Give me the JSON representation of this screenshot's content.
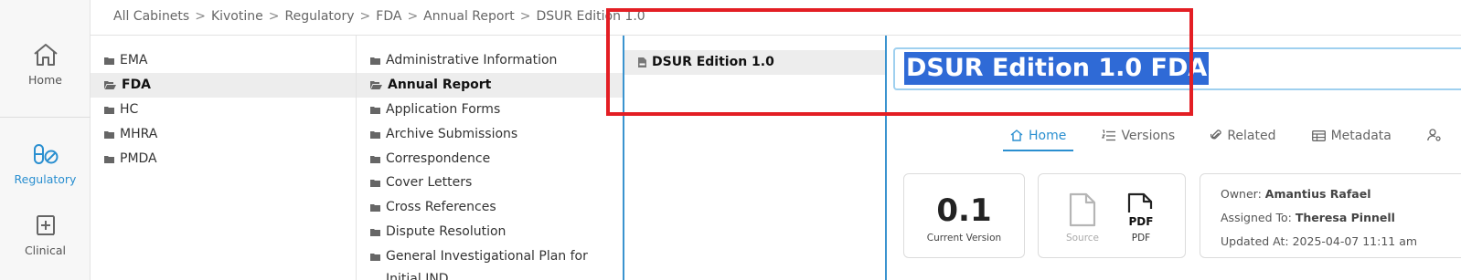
{
  "rail": {
    "home_label": "Home",
    "regulatory_label": "Regulatory",
    "clinical_label": "Clinical"
  },
  "breadcrumb": [
    "All Cabinets",
    "Kivotine",
    "Regulatory",
    "FDA",
    "Annual Report",
    "DSUR Edition 1.0"
  ],
  "breadcrumb_separator": ">",
  "column1": [
    {
      "label": "EMA",
      "selected": false
    },
    {
      "label": "FDA",
      "selected": true
    },
    {
      "label": "HC",
      "selected": false
    },
    {
      "label": "MHRA",
      "selected": false
    },
    {
      "label": "PMDA",
      "selected": false
    }
  ],
  "column2": [
    {
      "label": "Administrative Information",
      "selected": false
    },
    {
      "label": "Annual Report",
      "selected": true
    },
    {
      "label": "Application Forms",
      "selected": false
    },
    {
      "label": "Archive Submissions",
      "selected": false
    },
    {
      "label": "Correspondence",
      "selected": false
    },
    {
      "label": "Cover Letters",
      "selected": false
    },
    {
      "label": "Cross References",
      "selected": false
    },
    {
      "label": "Dispute Resolution",
      "selected": false
    },
    {
      "label": "General Investigational Plan for",
      "selected": false
    },
    {
      "label": "Initial IND",
      "selected": false
    }
  ],
  "column3": [
    {
      "label": "DSUR Edition 1.0",
      "selected": true
    }
  ],
  "detail": {
    "title_value": "DSUR Edition 1.0 FDA",
    "tabs": [
      "Home",
      "Versions",
      "Related",
      "Metadata"
    ],
    "active_tab": "Home",
    "current_version": "0.1",
    "current_version_label": "Current Version",
    "source_label": "Source",
    "pdf_label": "PDF",
    "pdf_icon_text": "PDF",
    "owner_label": "Owner:",
    "owner": "Amantius Rafael",
    "assigned_label": "Assigned To:",
    "assigned_to": "Theresa Pinnell",
    "updated_label": "Updated At:",
    "updated_at": "2025-04-07 11:11 am"
  },
  "colors": {
    "accent": "#2a8fd0",
    "selection": "#2f6ad6",
    "annotation": "#e31e24"
  }
}
